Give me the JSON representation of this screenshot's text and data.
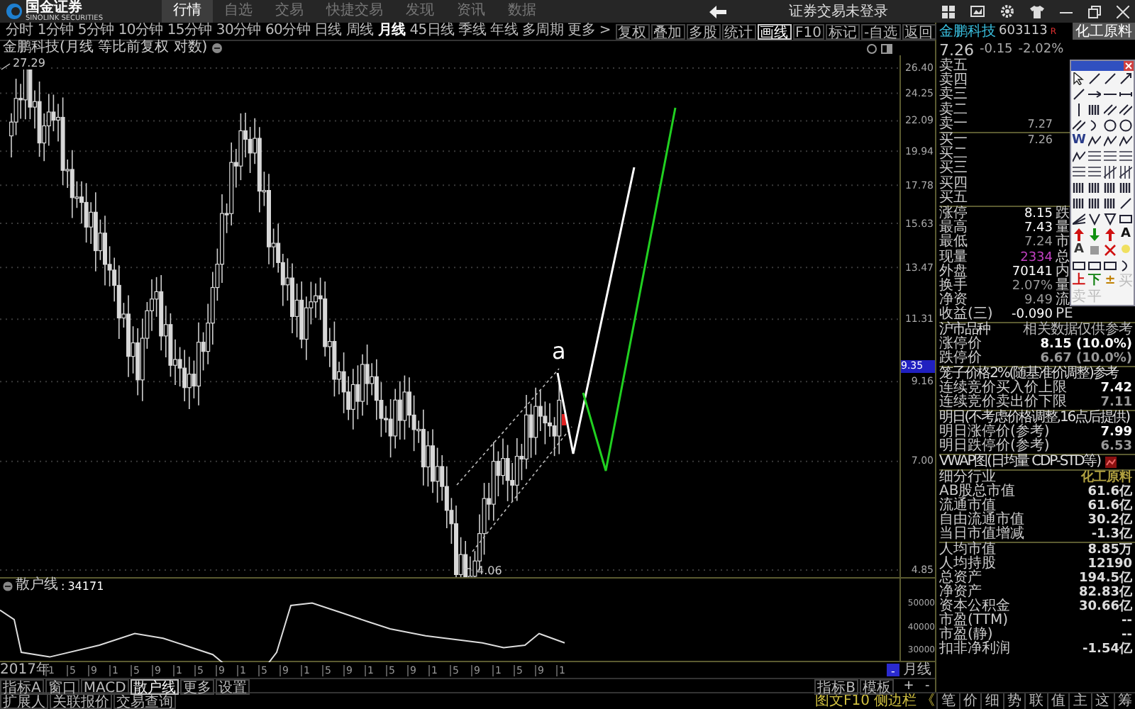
{
  "top_bar": {
    "logo_text": "国金证券",
    "logo_subtext": "SINOLINK SECURITIES",
    "login_status": "证券交易未登录",
    "nav": [
      {
        "label": "行情",
        "selected": true
      },
      {
        "label": "自选",
        "selected": false
      },
      {
        "label": "交易",
        "selected": false
      },
      {
        "label": "快捷交易",
        "selected": false
      },
      {
        "label": "发现",
        "selected": false
      },
      {
        "label": "资讯",
        "selected": false
      },
      {
        "label": "数据",
        "selected": false
      }
    ]
  },
  "toolbar": {
    "periods": [
      {
        "label": "分时",
        "selected": false
      },
      {
        "label": "1分钟",
        "selected": false
      },
      {
        "label": "5分钟",
        "selected": false
      },
      {
        "label": "10分钟",
        "selected": false
      },
      {
        "label": "15分钟",
        "selected": false
      },
      {
        "label": "30分钟",
        "selected": false
      },
      {
        "label": "60分钟",
        "selected": false
      },
      {
        "label": "日线",
        "selected": false
      },
      {
        "label": "周线",
        "selected": false
      },
      {
        "label": "月线",
        "selected": true
      },
      {
        "label": "45日线",
        "selected": false
      },
      {
        "label": "季线",
        "selected": false
      },
      {
        "label": "年线",
        "selected": false
      },
      {
        "label": "多周期",
        "selected": false
      },
      {
        "label": "更多 >",
        "selected": false
      }
    ],
    "actions": [
      {
        "label": "复权",
        "selected": false
      },
      {
        "label": "叠加",
        "selected": false
      },
      {
        "label": "多股",
        "selected": false
      },
      {
        "label": "统计",
        "selected": false
      },
      {
        "label": "画线",
        "selected": true
      },
      {
        "label": "F10",
        "selected": false
      },
      {
        "label": "标记",
        "selected": false
      },
      {
        "label": "-自选",
        "selected": false
      },
      {
        "label": "返回",
        "selected": false
      }
    ]
  },
  "chart": {
    "title": "金鹏科技(月线 等比前复权 对数)",
    "max_label": "27.29",
    "min_label": "4.06",
    "annotation": "a",
    "current_price": "9.35",
    "yticks": [
      "26.40",
      "24.25",
      "22.09",
      "19.94",
      "17.78",
      "15.63",
      "13.47",
      "11.31",
      "9.16",
      "7.00",
      "4.85"
    ]
  },
  "indicator": {
    "name": "散户线",
    "separator": ":",
    "value": "34171",
    "yticks": [
      "50000",
      "40000",
      "30000"
    ]
  },
  "date_axis": {
    "year": "2017年",
    "labels": [
      "1",
      "5",
      "9",
      "1",
      "5",
      "9",
      "1",
      "5",
      "9",
      "1",
      "5",
      "9",
      "1",
      "5",
      "9",
      "1",
      "5",
      "9",
      "1",
      "5",
      "9",
      "1",
      "5",
      "9",
      "1"
    ]
  },
  "period_label": "月线",
  "zoom_buttons": [
    "+",
    "-"
  ],
  "indicator_tabs": {
    "left": [
      {
        "label": "指标A",
        "selected": false
      },
      {
        "label": "窗口",
        "selected": false
      },
      {
        "label": "MACD",
        "selected": false
      },
      {
        "label": "散户线",
        "selected": true
      },
      {
        "label": "更多",
        "selected": false
      },
      {
        "label": "设置",
        "selected": false
      }
    ],
    "right": [
      {
        "label": "指标B",
        "selected": false
      },
      {
        "label": "模板",
        "selected": false
      }
    ]
  },
  "status_bar": {
    "left": [
      "扩展人",
      "关联报价",
      "交易查询"
    ],
    "right": [
      "图文F10",
      "侧边栏",
      "《"
    ]
  },
  "quote_panel": {
    "name": "金鹏科技",
    "code": "603113",
    "flag": "R",
    "industry_button": "化工原料",
    "price": "7.26",
    "change": "-0.15",
    "change_pct": "-2.02%",
    "asks": [
      {
        "label": "卖五"
      },
      {
        "label": "卖四"
      },
      {
        "label": "卖三"
      },
      {
        "label": "卖二"
      },
      {
        "label": "卖一",
        "price": "7.27"
      }
    ],
    "bids": [
      {
        "label": "买一",
        "price": "7.26"
      },
      {
        "label": "买二"
      },
      {
        "label": "买三"
      },
      {
        "label": "买四"
      },
      {
        "label": "买五"
      }
    ],
    "stats": [
      {
        "label": "涨停",
        "value": "8.15",
        "label2": "跌",
        "color": "#ffffff"
      },
      {
        "label": "最高",
        "value": "7.43",
        "label2": "量",
        "color": "#ffffff"
      },
      {
        "label": "最低",
        "value": "7.24",
        "label2": "市",
        "color": "#999999"
      },
      {
        "label": "现量",
        "value": "2334",
        "label2": "总",
        "color": "#c040c0"
      },
      {
        "label": "外盘",
        "value": "70141",
        "label2": "内",
        "color": "#ffffff"
      },
      {
        "label": "换手",
        "value": "2.07%",
        "label2": "量",
        "color": "#999999"
      },
      {
        "label": "净资",
        "value": "9.49",
        "label2": "流",
        "color": "#999999"
      },
      {
        "label": "收益(三)",
        "value": "-0.090",
        "label2": "PE",
        "color": "#ffffff"
      }
    ],
    "groups": [
      {
        "rows": [
          {
            "kind": "header",
            "label": "沪市品种",
            "note": "相关数据仅供参考"
          },
          {
            "kind": "row",
            "label": "涨停价",
            "value": "8.15 (10.0%)",
            "color": "#ffffff"
          },
          {
            "kind": "row",
            "label": "跌停价",
            "value": "6.67 (10.0%)",
            "color": "#999999"
          }
        ]
      },
      {
        "rows": [
          {
            "kind": "header",
            "label": "笼子价格2%(随基准价调整)参考"
          },
          {
            "kind": "row",
            "label": "连续竞价买入价上限",
            "value": "7.42",
            "color": "#ffffff"
          },
          {
            "kind": "row",
            "label": "连续竞价卖出价下限",
            "value": "7.11",
            "color": "#999999"
          }
        ]
      },
      {
        "rows": [
          {
            "kind": "header",
            "label": "明日(不考虑价格调整,16点后提供)"
          },
          {
            "kind": "row",
            "label": "明日涨停价(参考)",
            "value": "7.99",
            "color": "#ffffff"
          },
          {
            "kind": "row",
            "label": "明日跌停价(参考)",
            "value": "6.53",
            "color": "#999999"
          }
        ]
      },
      {
        "rows": [
          {
            "kind": "link",
            "label": "VWAP图(日均量 CDP-STD等)"
          }
        ]
      },
      {
        "rows": [
          {
            "kind": "row",
            "label": "细分行业",
            "value": "化工原料",
            "color": "#b0a040"
          },
          {
            "kind": "row",
            "label": "AB股总市值",
            "value": "61.6亿",
            "color": "#dddddd"
          },
          {
            "kind": "row",
            "label": "流通市值",
            "value": "61.6亿",
            "color": "#dddddd"
          },
          {
            "kind": "row",
            "label": "自由流通市值",
            "value": "30.2亿",
            "color": "#dddddd"
          },
          {
            "kind": "row",
            "label": "当日市值增减",
            "value": "-1.3亿",
            "color": "#dddddd"
          }
        ]
      },
      {
        "rows": [
          {
            "kind": "row",
            "label": "人均市值",
            "value": "8.85万",
            "color": "#dddddd"
          },
          {
            "kind": "row",
            "label": "人均持股",
            "value": "12190",
            "color": "#dddddd"
          },
          {
            "kind": "row",
            "label": "总资产",
            "value": "194.5亿",
            "color": "#dddddd"
          },
          {
            "kind": "row",
            "label": "净资产",
            "value": "82.83亿",
            "color": "#dddddd"
          },
          {
            "kind": "row",
            "label": "资本公积金",
            "value": "30.66亿",
            "color": "#dddddd"
          },
          {
            "kind": "row",
            "label": "市盈(TTM)",
            "value": "--",
            "color": "#dddddd"
          },
          {
            "kind": "row",
            "label": "市盈(静)",
            "value": "--",
            "color": "#dddddd"
          },
          {
            "kind": "row",
            "label": "扣非净利润",
            "value": "-1.54亿",
            "color": "#dddddd"
          }
        ]
      }
    ],
    "tabs": [
      "笔",
      "价",
      "细",
      "势",
      "联",
      "值",
      "主",
      "这",
      "筹"
    ]
  },
  "draw_palette": {
    "tools": [
      {
        "kind": "cursor"
      },
      {
        "kind": "diag"
      },
      {
        "kind": "diag"
      },
      {
        "kind": "ray"
      },
      {
        "kind": "diag"
      },
      {
        "kind": "hray"
      },
      {
        "kind": "hline"
      },
      {
        "kind": "segment"
      },
      {
        "kind": "vline"
      },
      {
        "kind": "bars"
      },
      {
        "kind": "parallel"
      },
      {
        "kind": "parallel"
      },
      {
        "kind": "parallel"
      },
      {
        "kind": "arc"
      },
      {
        "kind": "circle"
      },
      {
        "kind": "circle"
      },
      {
        "kind": "glyph",
        "text": "W",
        "color": "#2a3c8a"
      },
      {
        "kind": "zigzag"
      },
      {
        "kind": "zigzag"
      },
      {
        "kind": "zigzag"
      },
      {
        "kind": "zigzag"
      },
      {
        "kind": "fib"
      },
      {
        "kind": "fib"
      },
      {
        "kind": "fib"
      },
      {
        "kind": "fib"
      },
      {
        "kind": "fib"
      },
      {
        "kind": "grid"
      },
      {
        "kind": "grid"
      },
      {
        "kind": "bars"
      },
      {
        "kind": "bars"
      },
      {
        "kind": "bars"
      },
      {
        "kind": "bars"
      },
      {
        "kind": "bars"
      },
      {
        "kind": "bars"
      },
      {
        "kind": "bars"
      },
      {
        "kind": "diag"
      },
      {
        "kind": "fan"
      },
      {
        "kind": "vee"
      },
      {
        "kind": "triangle"
      },
      {
        "kind": "rect"
      },
      {
        "kind": "up"
      },
      {
        "kind": "down"
      },
      {
        "kind": "up"
      },
      {
        "kind": "glyph",
        "text": "A",
        "color": "#111111"
      },
      {
        "kind": "glyph",
        "text": "A",
        "color": "#333333"
      },
      {
        "kind": "square"
      },
      {
        "kind": "cross"
      },
      {
        "kind": "bulb"
      },
      {
        "kind": "rect"
      },
      {
        "kind": "rect"
      },
      {
        "kind": "rect"
      },
      {
        "kind": "arc"
      },
      {
        "kind": "glyph",
        "text": "上",
        "color": "#d01010"
      },
      {
        "kind": "glyph",
        "text": "下",
        "color": "#108010"
      },
      {
        "kind": "glyph",
        "text": "±",
        "color": "#c08000"
      }
    ],
    "order_tools": [
      {
        "label": "买",
        "disabled": true
      },
      {
        "label": "卖",
        "disabled": true
      },
      {
        "label": "平",
        "disabled": true
      }
    ]
  }
}
